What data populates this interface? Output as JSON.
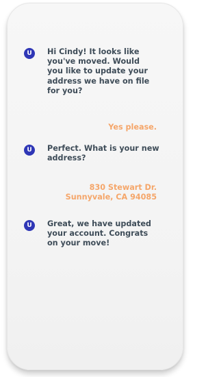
{
  "chat": {
    "avatar_letter": "U",
    "messages": [
      {
        "sender": "bot",
        "text": "Hi Cindy! It looks like\nyou've moved. Would\nyou like to update your\naddress we have on file\nfor you?"
      },
      {
        "sender": "user",
        "text": "Yes please."
      },
      {
        "sender": "bot",
        "text": "Perfect. What is your new\naddress?"
      },
      {
        "sender": "user",
        "text": "830 Stewart Dr.\nSunnyvale, CA 94085"
      },
      {
        "sender": "bot",
        "text": "Great, we have updated\nyour account. Congrats\non your move!"
      }
    ]
  },
  "colors": {
    "avatar": "#2f37b6",
    "bot_text": "#3e4c58",
    "user_text": "#f5a66a"
  }
}
